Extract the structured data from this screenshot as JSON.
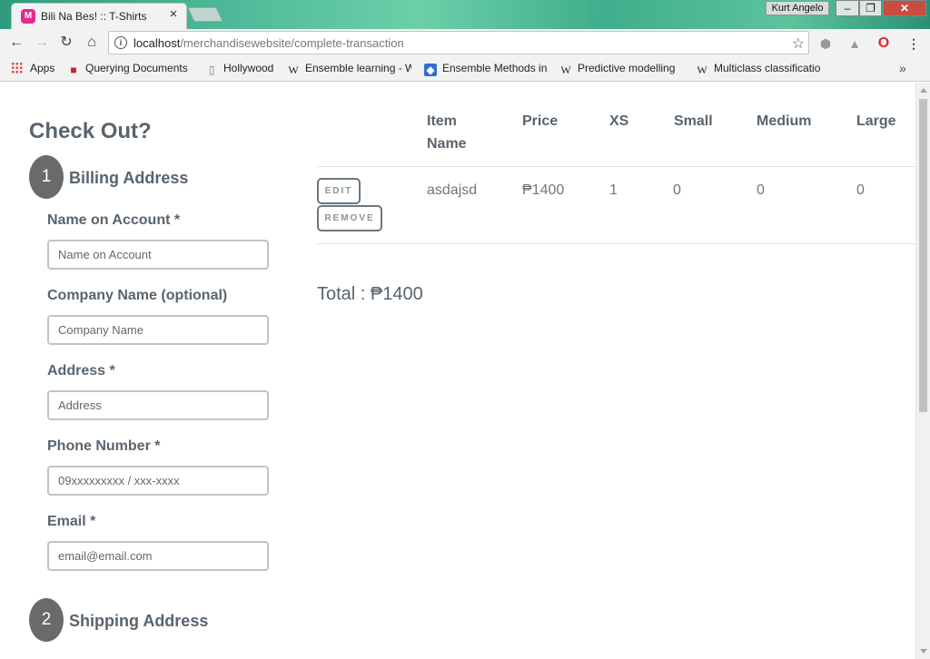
{
  "browser": {
    "tab_title": "Bili Na Bes! :: T-Shirts",
    "tab_favicon": "M",
    "profile_name": "Kurt Angelo",
    "url_host": "localhost",
    "url_path": "/merchandisewebsite/complete-transaction",
    "bookmarks": [
      {
        "label": "Apps",
        "icon": "apps-grid-icon"
      },
      {
        "label": "Querying Documents",
        "icon": "red-square-icon"
      },
      {
        "label": "Hollywood",
        "icon": "page-icon"
      },
      {
        "label": "Ensemble learning - W",
        "icon": "wikipedia-icon"
      },
      {
        "label": "Ensemble Methods in",
        "icon": "blue-diamond-icon"
      },
      {
        "label": "Predictive modelling",
        "icon": "wikipedia-icon"
      },
      {
        "label": "Multiclass classificatio",
        "icon": "wikipedia-icon"
      }
    ],
    "bookmarks_more": "»"
  },
  "checkout": {
    "title": "Check Out?",
    "billing": {
      "step": "1",
      "title": "Billing Address",
      "fields": [
        {
          "label": "Name on Account *",
          "placeholder": "Name on Account"
        },
        {
          "label": "Company Name (optional)",
          "placeholder": "Company Name"
        },
        {
          "label": "Address *",
          "placeholder": "Address"
        },
        {
          "label": "Phone Number *",
          "placeholder": "09xxxxxxxxx / xxx-xxxx"
        },
        {
          "label": "Email *",
          "placeholder": "email@email.com"
        }
      ]
    },
    "shipping": {
      "step": "2",
      "title": "Shipping Address"
    }
  },
  "cart": {
    "headers": {
      "item_line1": "Item",
      "item_line2": "Name",
      "price": "Price",
      "xs": "XS",
      "small": "Small",
      "medium": "Medium",
      "large": "Large"
    },
    "rows": [
      {
        "edit_label": "EDIT",
        "remove_label": "REMOVE",
        "item_name": "asdajsd",
        "price": "₱1400",
        "xs": "1",
        "small": "0",
        "medium": "0",
        "large": "0"
      }
    ],
    "total": "Total : ₱1400"
  },
  "colors": {
    "heading": "#59646e",
    "step_circle": "#6a6a6a",
    "titlebar_accent": "#47b495"
  }
}
